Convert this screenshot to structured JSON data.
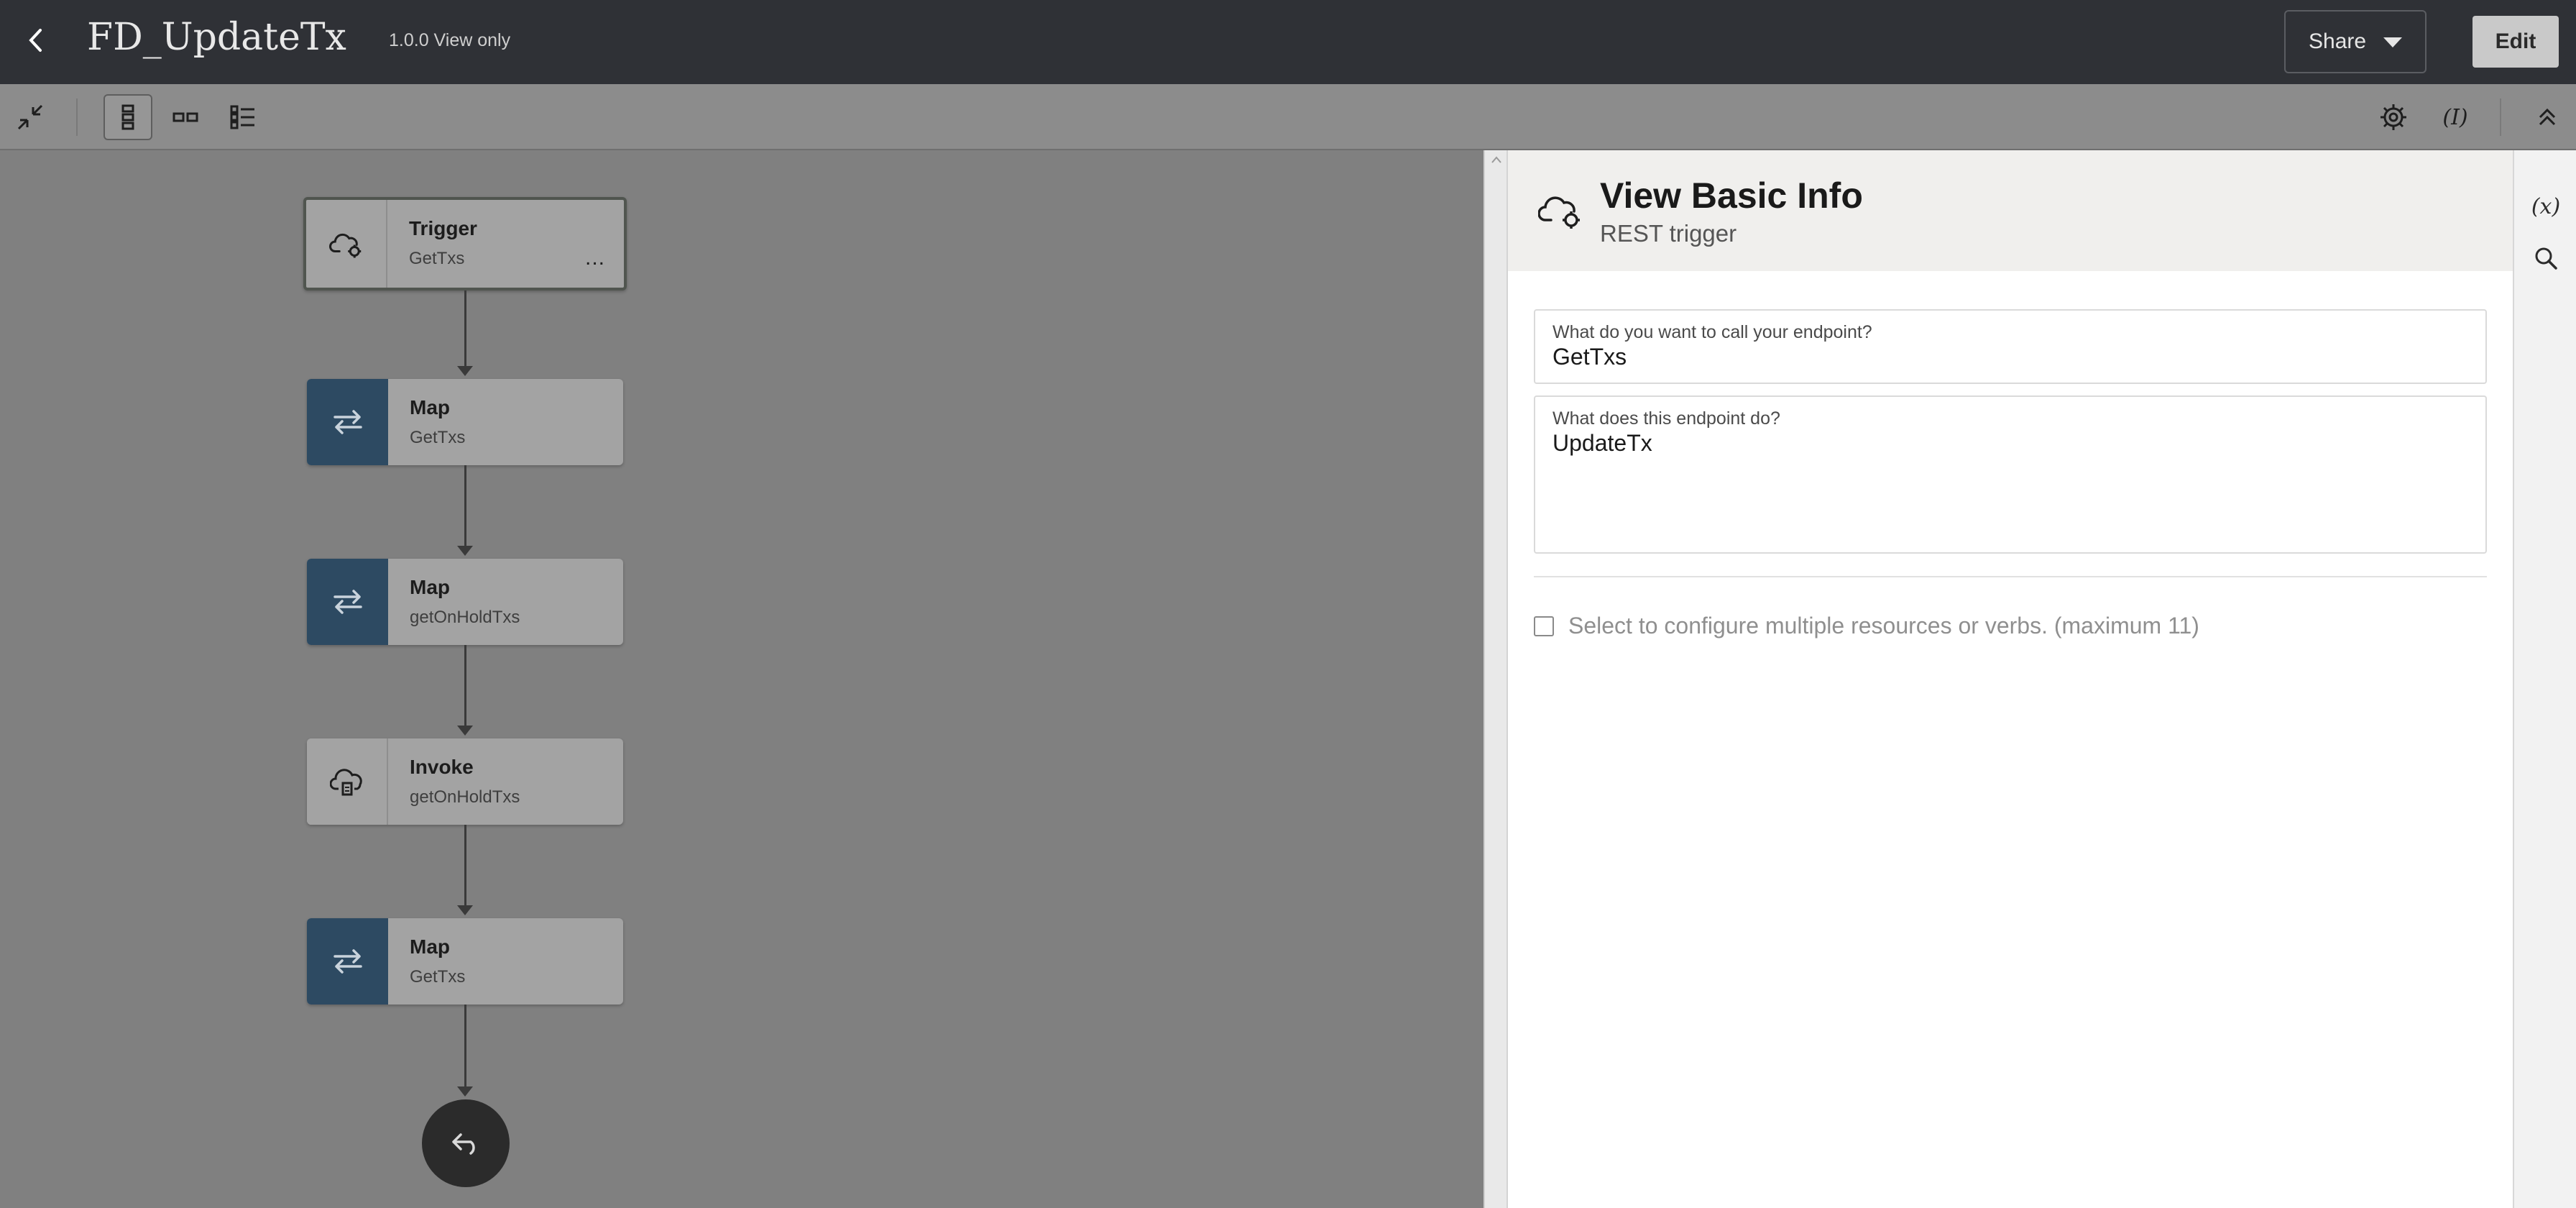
{
  "header": {
    "title": "FD_UpdateTx",
    "version_label": "1.0.0 View only",
    "share_label": "Share",
    "edit_label": "Edit"
  },
  "toolbar": {
    "expression_label": "(I)"
  },
  "flow": {
    "nodes": [
      {
        "title": "Trigger",
        "subtitle": "GetTxs",
        "kind": "trigger",
        "icon": "cloud-gear-icon"
      },
      {
        "title": "Map",
        "subtitle": "GetTxs",
        "kind": "map",
        "icon": "swap-arrows-icon"
      },
      {
        "title": "Map",
        "subtitle": "getOnHoldTxs",
        "kind": "map",
        "icon": "swap-arrows-icon"
      },
      {
        "title": "Invoke",
        "subtitle": "getOnHoldTxs",
        "kind": "invoke",
        "icon": "cloud-file-icon"
      },
      {
        "title": "Map",
        "subtitle": "GetTxs",
        "kind": "map",
        "icon": "swap-arrows-icon"
      }
    ],
    "trigger_more_label": "...",
    "end_icon": "return-arrow-icon"
  },
  "panel": {
    "title": "View Basic Info",
    "subtitle": "REST trigger",
    "fields": [
      {
        "label": "What do you want to call your endpoint?",
        "value": "GetTxs"
      },
      {
        "label": "What does this endpoint do?",
        "value": "UpdateTx"
      }
    ],
    "checkbox_label": "Select to configure multiple resources or verbs. (maximum 11)"
  },
  "rail": {
    "variables_label": "(x)"
  }
}
